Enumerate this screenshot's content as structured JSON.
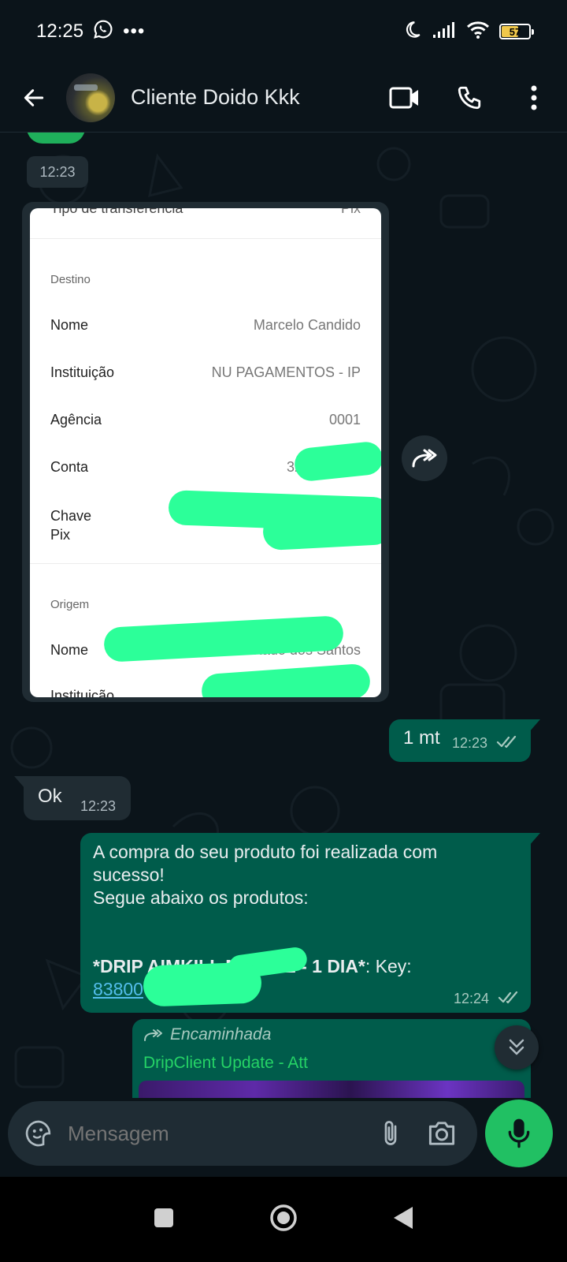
{
  "status_bar": {
    "time": "12:25",
    "battery": "57"
  },
  "header": {
    "contact_name": "Cliente Doido Kkk"
  },
  "messages": [
    {
      "type": "time_only",
      "time": "12:23"
    },
    {
      "type": "image",
      "receipt": {
        "top_row_label": "Tipo de transferência",
        "top_row_value": "Pix",
        "destino_heading": "Destino",
        "rows_destino": [
          {
            "label": "Nome",
            "value": "Marcelo Candido"
          },
          {
            "label": "Instituição",
            "value": "NU PAGAMENTOS - IP"
          },
          {
            "label": "Agência",
            "value": "0001"
          },
          {
            "label": "Conta",
            "value": "32"
          },
          {
            "label": "Chave Pix",
            "value": ""
          }
        ],
        "origem_heading": "Origem",
        "rows_origem": [
          {
            "label": "Nome",
            "value": "Furtado dos Santos"
          },
          {
            "label": "Instituição",
            "value": ""
          }
        ]
      }
    },
    {
      "type": "text_out",
      "text": "1 mt",
      "time": "12:23"
    },
    {
      "type": "text_in",
      "text": "Ok",
      "time": "12:23"
    },
    {
      "type": "text_out",
      "line1": "A compra do seu produto foi realizada com",
      "line2": "sucesso!",
      "line3": "Segue abaixo os produtos:",
      "product_bold": "*DRIP AIMKILL MOBILE - 1 DIA*",
      "product_suffix": ": Key:",
      "key_link": "83800",
      "time": "12:24"
    },
    {
      "type": "forwarded",
      "forwarded_label": "Encaminhada",
      "sender": "DripClient Update - Att"
    }
  ],
  "composer": {
    "placeholder": "Mensagem"
  },
  "colors": {
    "incoming": "#202c33",
    "outgoing": "#005c4b",
    "accent": "#21c063",
    "redaction": "#2cff99",
    "link": "#53bdeb"
  }
}
